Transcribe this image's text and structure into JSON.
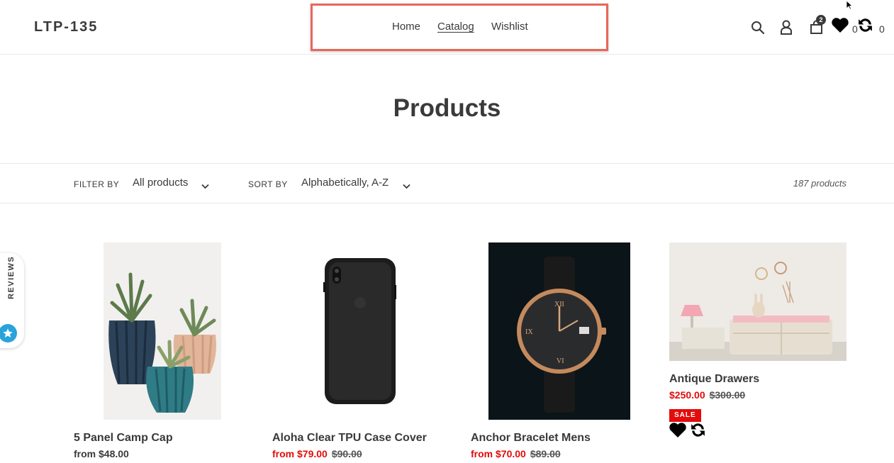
{
  "header": {
    "logo": "LTP-135",
    "nav": [
      {
        "label": "Home"
      },
      {
        "label": "Catalog"
      },
      {
        "label": "Wishlist"
      }
    ],
    "cart_count": "2",
    "wishlist_count": "0",
    "compare_count": "0"
  },
  "page": {
    "title": "Products"
  },
  "filters": {
    "filter_label": "FILTER BY",
    "filter_value": "All products",
    "sort_label": "SORT BY",
    "sort_value": "Alphabetically, A-Z",
    "product_count": "187 products"
  },
  "products": [
    {
      "title": "5 Panel Camp Cap",
      "price": "from $48.00",
      "compare": "",
      "on_sale": false
    },
    {
      "title": "Aloha Clear TPU Case Cover",
      "price": "from $79.00",
      "compare": "$90.00",
      "on_sale": true
    },
    {
      "title": "Anchor Bracelet Mens",
      "price": "from $70.00",
      "compare": "$89.00",
      "on_sale": true
    },
    {
      "title": "Antique Drawers",
      "price": "$250.00",
      "compare": "$300.00",
      "on_sale": true,
      "badge": "SALE"
    }
  ],
  "reviews_widget": {
    "label": "REVIEWS"
  },
  "colors": {
    "accent_sale": "#e30b0b",
    "nav_highlight": "#e8675a",
    "reviews_star": "#29a3d9"
  }
}
